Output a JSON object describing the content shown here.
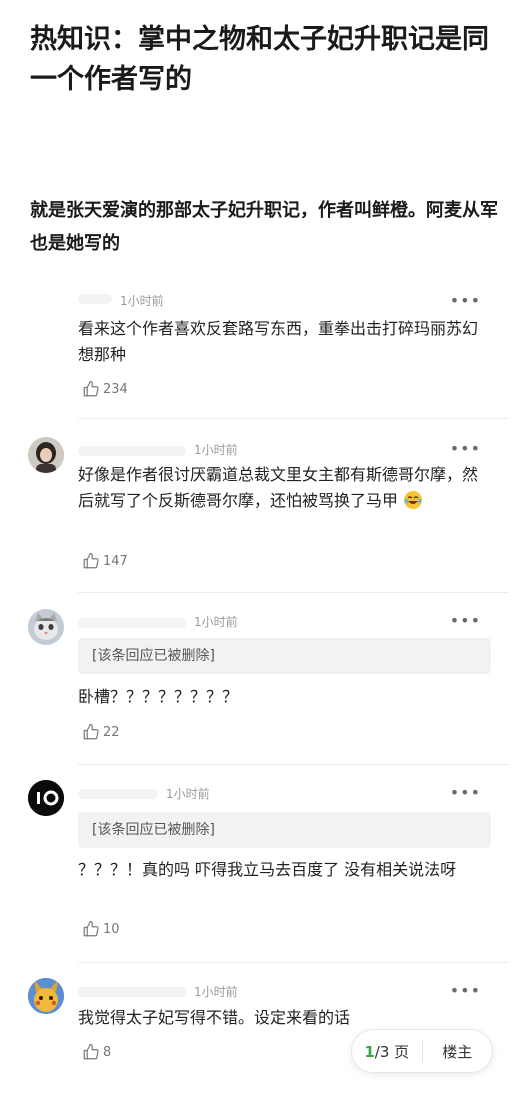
{
  "post": {
    "title": "热知识：掌中之物和太子妃升职记是同一个作者写的",
    "body": "就是张天爱演的那部太子妃升职记，作者叫鲜橙。阿麦从军也是她写的"
  },
  "comments": [
    {
      "time": "1小时前",
      "quote": "",
      "text": "看来这个作者喜欢反套路写东西，重拳出击打碎玛丽苏幻想那种",
      "likes": "234",
      "more": "•••"
    },
    {
      "time": "1小时前",
      "quote": "",
      "text": "好像是作者很讨厌霸道总裁文里女主都有斯德哥尔摩，然后就写了个反斯德哥尔摩，还怕被骂换了马甲",
      "likes": "147",
      "more": "•••",
      "emoji": "laughing-tears-emoji"
    },
    {
      "time": "1小时前",
      "quote": "[该条回应已被删除]",
      "text": "卧槽？？？？？？？？",
      "likes": "22",
      "more": "•••"
    },
    {
      "time": "1小时前",
      "quote": "[该条回应已被删除]",
      "text": "？？？！真的吗 吓得我立马去百度了 没有相关说法呀",
      "likes": "10",
      "more": "•••"
    },
    {
      "time": "1小时前",
      "quote": "",
      "text": "我觉得太子妃写得不错。设定来看的话",
      "likes": "8",
      "more": "•••"
    }
  ],
  "pager": {
    "current": "1",
    "total": "/3 页",
    "owner": "楼主"
  },
  "colors": {
    "accent": "#3aa84a",
    "text": "#222222",
    "muted": "#9a9a9a",
    "quote_bg": "#f2f2f2"
  }
}
